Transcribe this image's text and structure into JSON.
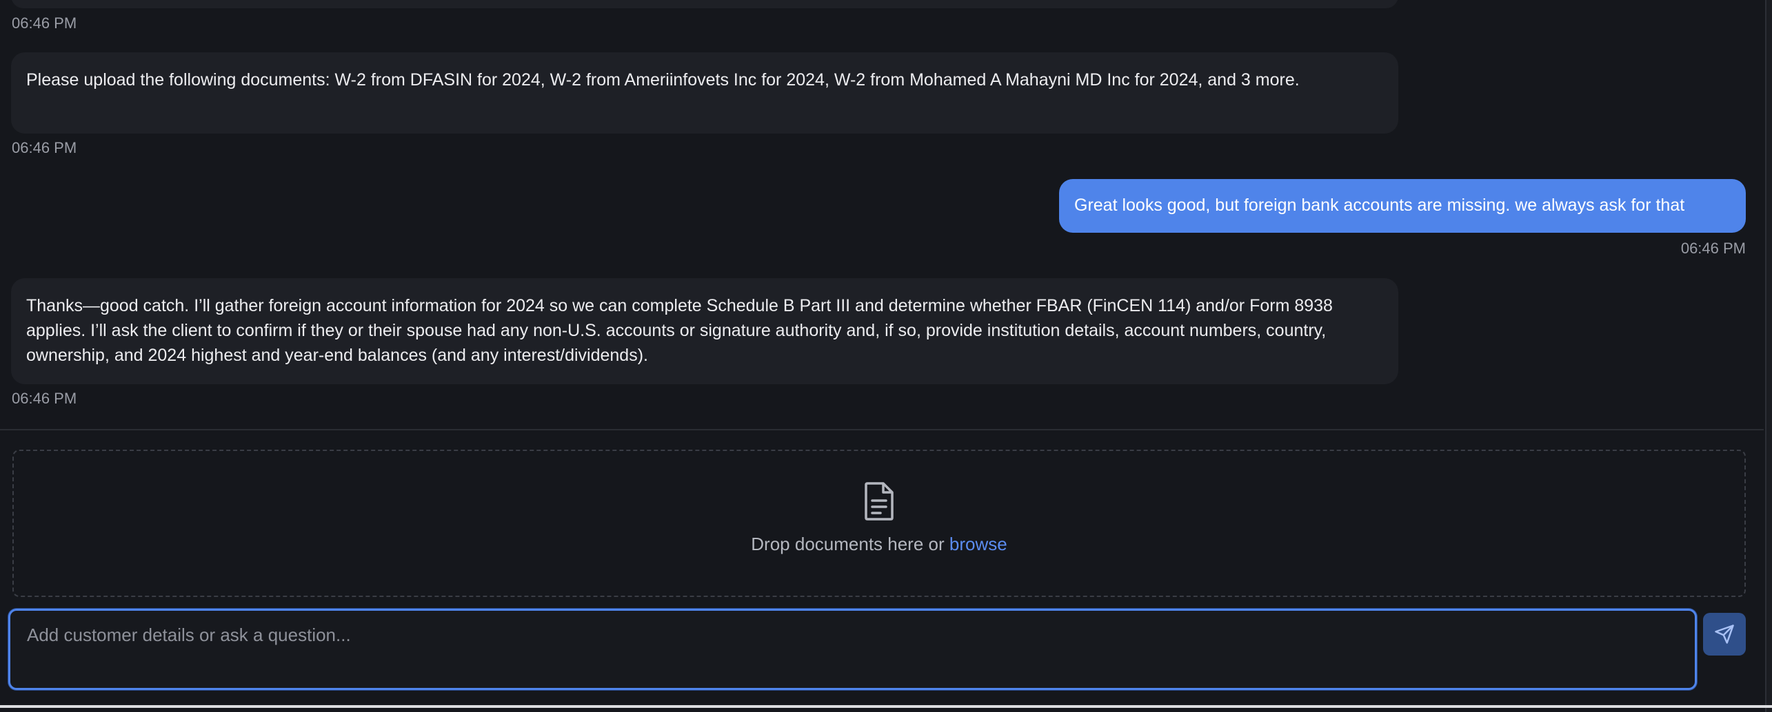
{
  "messages": [
    {
      "role": "assistant",
      "time": "06:46 PM",
      "text": "Please upload the following documents: W-2 from DFASIN for 2024, W-2 from Ameriinfovets Inc for 2024, W-2 from Mohamed A Mahayni MD Inc for 2024, and 3 more."
    },
    {
      "role": "user",
      "time": "06:46 PM",
      "text": "Great looks good, but foreign bank accounts are missing. we always ask for that"
    },
    {
      "role": "assistant",
      "time": "06:46 PM",
      "text": "Thanks—good catch. I’ll gather foreign account information for 2024 so we can complete Schedule B Part III and determine whether FBAR (FinCEN 114) and/or Form 8938 applies. I’ll ask the client to confirm if they or their spouse had any non-U.S. accounts or signature authority and, if so, provide institution details, account numbers, country, ownership, and 2024 highest and year-end balances (and any interest/dividends)."
    }
  ],
  "top_timestamp": "06:46 PM",
  "dropzone": {
    "icon": "document-icon",
    "text": "Drop documents here or",
    "link": "browse"
  },
  "composer": {
    "placeholder": "Add customer details or ask a question...",
    "value": "",
    "send_icon": "send-icon"
  },
  "colors": {
    "background": "#15171c",
    "assistant_bubble": "#1e2026",
    "user_bubble": "#4f84ea",
    "accent": "#5b8cf0"
  }
}
